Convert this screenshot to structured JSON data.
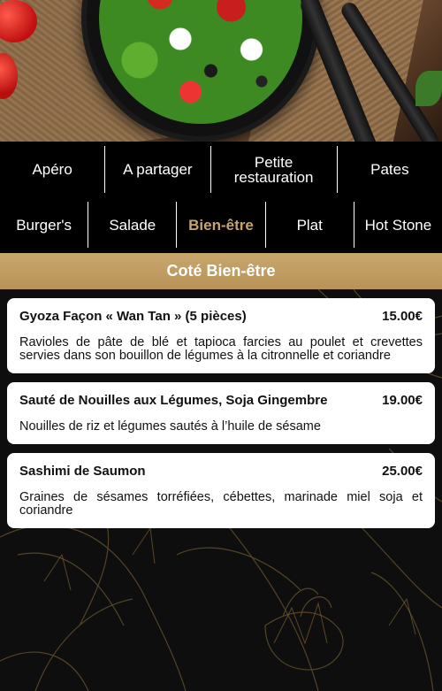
{
  "nav": {
    "row1": [
      "Apéro",
      "A partager",
      "Petite restauration",
      "Pates"
    ],
    "row2": [
      "Burger's",
      "Salade",
      "Bien-être",
      "Plat",
      "Hot Stone"
    ],
    "active": "Bien-être"
  },
  "section": {
    "title": "Coté Bien-être"
  },
  "items": [
    {
      "name": "Gyoza Façon « Wan Tan » (5 pièces)",
      "price": "15.00€",
      "description": "Ravioles de pâte de blé et tapioca farcies au poulet et crevettes servies dans son bouillon de légumes à la citronnelle et coriandre"
    },
    {
      "name": "Sauté de Nouilles aux Légumes, Soja Gingembre",
      "price": "19.00€",
      "description": "Nouilles de riz et légumes sautés à l’huile de sésame"
    },
    {
      "name": "Sashimi de Saumon",
      "price": "25.00€",
      "description": "Graines de sésames torréfiées, cébettes, marinade miel soja et coriandre"
    }
  ],
  "colors": {
    "accent": "#c8a46a",
    "nav_bg": "#000000",
    "card_bg": "#ffffff"
  }
}
